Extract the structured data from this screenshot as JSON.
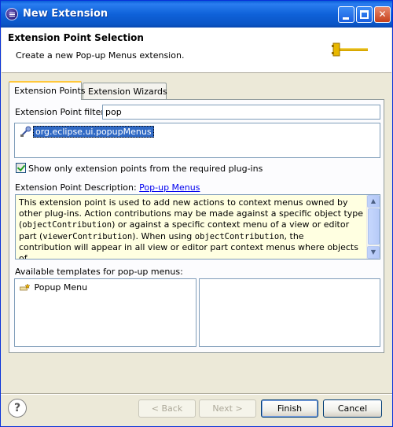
{
  "window": {
    "title": "New Extension"
  },
  "header": {
    "title": "Extension Point Selection",
    "description": "Create a new Pop-up Menus extension."
  },
  "tabs": [
    {
      "label": "Extension Points",
      "active": true
    },
    {
      "label": "Extension Wizards",
      "active": false
    }
  ],
  "filter": {
    "label": "Extension Point filter:",
    "value": "pop"
  },
  "extension_points": {
    "items": [
      {
        "label": "org.eclipse.ui.popupMenus",
        "selected": true,
        "icon": "extension-point-icon"
      }
    ]
  },
  "show_required": {
    "label": "Show only extension points from the required plug-ins",
    "checked": true
  },
  "description_section": {
    "label": "Extension Point Description:",
    "link": "Pop-up Menus",
    "lines": [
      "This extension point is used to add new actions to context menus owned by",
      "other plug-ins. Action contributions may be made against a specific object type",
      "(",
      "objectContribution",
      ") or against a specific context menu of a view or editor",
      "part (",
      "viewerContribution",
      "). When using ",
      "objectContribution",
      ", the",
      "contribution will appear in all view or editor part context menus where objects of"
    ]
  },
  "templates": {
    "label": "Available templates for pop-up menus:",
    "items": [
      {
        "label": "Popup Menu",
        "icon": "template-icon"
      }
    ]
  },
  "buttons": {
    "help": "?",
    "back": "< Back",
    "next": "Next >",
    "finish": "Finish",
    "cancel": "Cancel"
  },
  "colors": {
    "titlebar": "#0a5fd8",
    "selection": "#316ac5",
    "description_bg": "#ffffe1",
    "link": "#0000ee"
  }
}
